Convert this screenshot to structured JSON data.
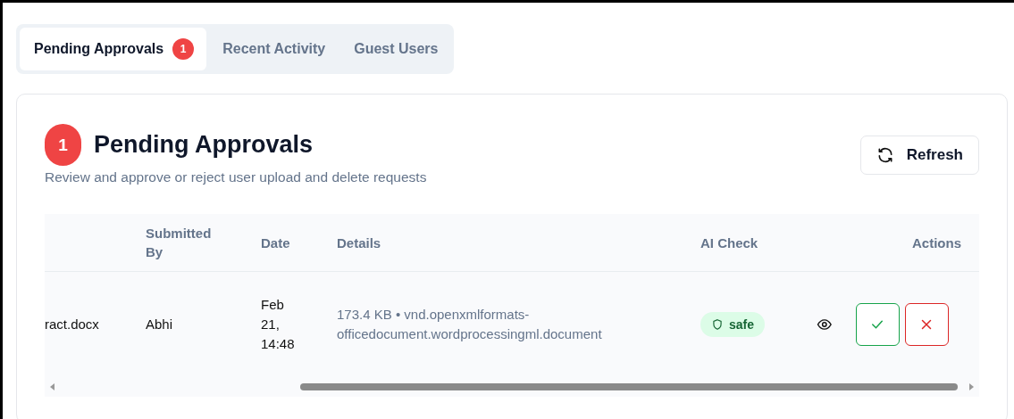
{
  "tabs": [
    {
      "label": "Pending Approvals",
      "badge": "1",
      "selected": true
    },
    {
      "label": "Recent Activity",
      "selected": false
    },
    {
      "label": "Guest Users",
      "selected": false
    }
  ],
  "panel": {
    "count": "1",
    "title": "Pending Approvals",
    "subtitle": "Review and approve or reject user upload and delete requests",
    "refresh_button": "Refresh"
  },
  "table": {
    "columns": [
      "Submitted By",
      "Date",
      "Details",
      "AI Check",
      "Actions"
    ],
    "rows": [
      {
        "file": "ract.docx",
        "submitted_by": "Abhi",
        "date": "Feb 21, 14:48",
        "details": "173.4 KB • vnd.openxmlformats-officedocument.wordprocessingml.document",
        "ai_check": {
          "label": "safe"
        }
      }
    ]
  }
}
